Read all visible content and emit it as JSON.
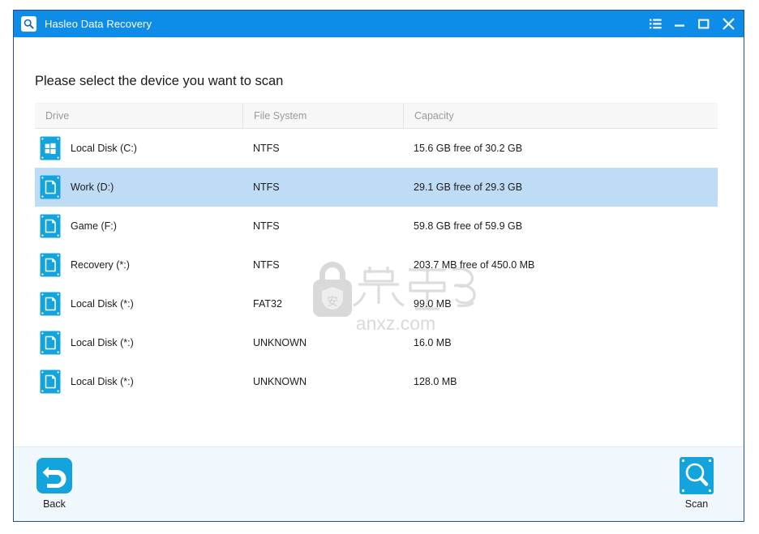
{
  "window": {
    "title": "Hasleo Data Recovery",
    "app_icon": "magnifier-icon",
    "controls": [
      {
        "name": "menu-button",
        "icon": "list-menu-icon"
      },
      {
        "name": "minimize-button",
        "icon": "minimize-icon"
      },
      {
        "name": "maximize-button",
        "icon": "maximize-icon"
      },
      {
        "name": "close-button",
        "icon": "close-icon"
      }
    ],
    "accent_color": "#0d8ce8",
    "border_color": "#2a4b8d"
  },
  "main": {
    "prompt": "Please select the device you want to scan",
    "table": {
      "columns": [
        "Drive",
        "File System",
        "Capacity"
      ],
      "rows": [
        {
          "icon": "windows-drive-icon",
          "drive": "Local Disk (C:)",
          "file_system": "NTFS",
          "capacity": "15.6 GB free of 30.2 GB",
          "selected": false
        },
        {
          "icon": "document-drive-icon",
          "drive": "Work (D:)",
          "file_system": "NTFS",
          "capacity": "29.1 GB free of 29.3 GB",
          "selected": true
        },
        {
          "icon": "document-drive-icon",
          "drive": "Game (F:)",
          "file_system": "NTFS",
          "capacity": "59.8 GB free of 59.9 GB",
          "selected": false
        },
        {
          "icon": "document-drive-icon",
          "drive": "Recovery (*:)",
          "file_system": "NTFS",
          "capacity": "203.7 MB free of 450.0 MB",
          "selected": false
        },
        {
          "icon": "document-drive-icon",
          "drive": "Local Disk (*:)",
          "file_system": "FAT32",
          "capacity": "99.0 MB",
          "selected": false
        },
        {
          "icon": "document-drive-icon",
          "drive": "Local Disk (*:)",
          "file_system": "UNKNOWN",
          "capacity": "16.0 MB",
          "selected": false
        },
        {
          "icon": "document-drive-icon",
          "drive": "Local Disk (*:)",
          "file_system": "UNKNOWN",
          "capacity": "128.0 MB",
          "selected": false
        }
      ]
    },
    "selection_color": "#bfdcf7",
    "drive_icon_color": "#14a4dd"
  },
  "watermark": {
    "text_cn": "安下载",
    "text_url": "anxz.com",
    "color": "#d6d6d6"
  },
  "footer": {
    "back": {
      "label": "Back",
      "icon": "back-arrow-icon"
    },
    "scan": {
      "label": "Scan",
      "icon": "scan-magnifier-icon"
    },
    "background": "#f0f8fd"
  }
}
